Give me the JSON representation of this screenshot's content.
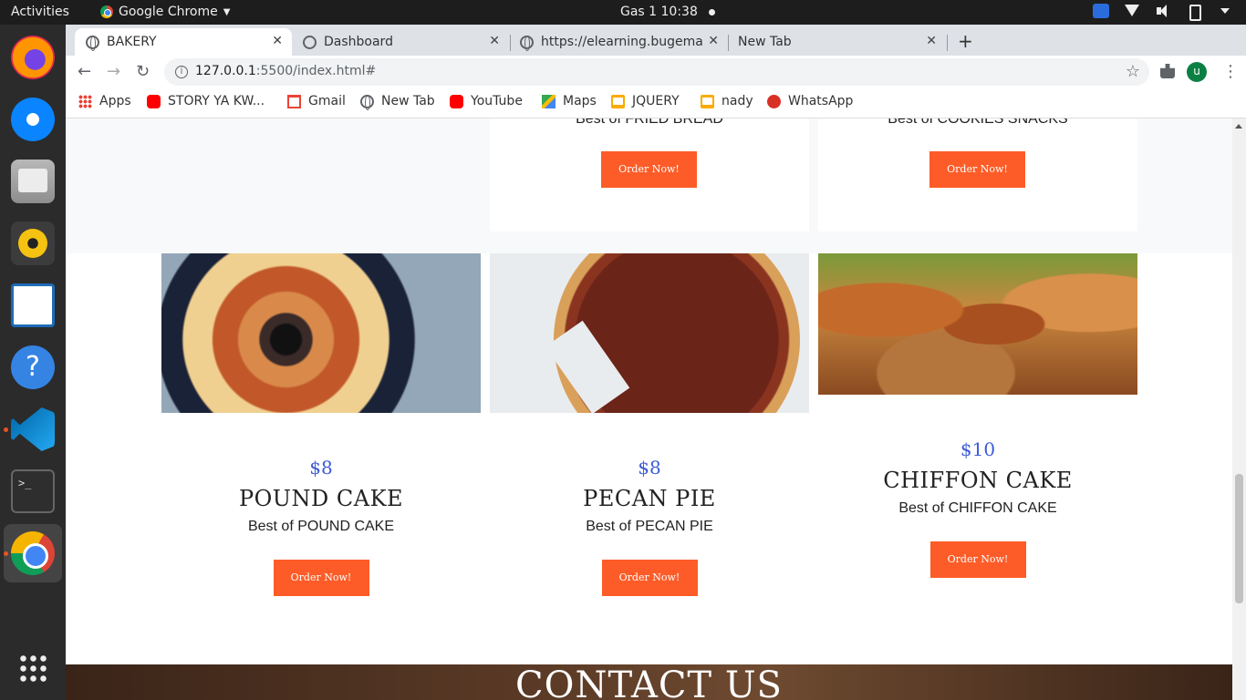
{
  "desktop": {
    "activities": "Activities",
    "app_menu": "Google Chrome",
    "clock": "Gas 1  10:38"
  },
  "browser": {
    "tabs": [
      {
        "title": "BAKERY",
        "active": true
      },
      {
        "title": "Dashboard",
        "active": false
      },
      {
        "title": "https://elearning.bugema",
        "active": false
      },
      {
        "title": "New Tab",
        "active": false
      }
    ],
    "address": {
      "host": "127.0.0.1",
      "rest": ":5500/index.html#"
    },
    "profile_initial": "u",
    "bookmarks": [
      {
        "label": "Apps",
        "icon": "apps-grid-icon"
      },
      {
        "label": "STORY YA KW...",
        "icon": "youtube-icon"
      },
      {
        "label": "Gmail",
        "icon": "gmail-icon"
      },
      {
        "label": "New Tab",
        "icon": "globe-icon"
      },
      {
        "label": "YouTube",
        "icon": "youtube-icon"
      },
      {
        "label": "Maps",
        "icon": "maps-icon"
      },
      {
        "label": "JQUERY",
        "icon": "folder-icon"
      },
      {
        "label": "nady",
        "icon": "folder-icon"
      },
      {
        "label": "WhatsApp",
        "icon": "whatsapp-icon"
      }
    ]
  },
  "page": {
    "top_cards": [
      {
        "desc": "Best of FRIED BREAD",
        "button": "Order Now!"
      },
      {
        "desc": "Best of COOKIES SNACKS",
        "button": "Order Now!"
      }
    ],
    "products": [
      {
        "price": "$8",
        "name": "POUND CAKE",
        "desc": "Best of POUND CAKE",
        "button": "Order Now!"
      },
      {
        "price": "$8",
        "name": "PECAN PIE",
        "desc": "Best of PECAN PIE",
        "button": "Order Now!"
      },
      {
        "price": "$10",
        "name": "CHIFFON CAKE",
        "desc": "Best of CHIFFON CAKE",
        "button": "Order Now!"
      }
    ],
    "contact_heading": "CONTACT US",
    "accent_color": "#fd5c28",
    "price_color": "#3d5bd9"
  }
}
